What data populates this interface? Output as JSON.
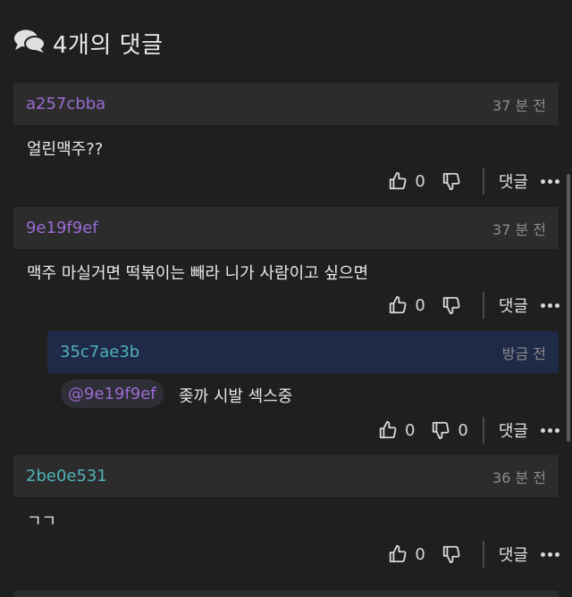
{
  "header": {
    "icon": "chat-bubbles-icon",
    "title": "4개의 댓글"
  },
  "colors": {
    "purple": "#9b6bd4",
    "teal": "#4fb3b8",
    "reply_bg": "#1e2a47"
  },
  "comments": [
    {
      "author": "a257cbba",
      "time": "37 분 전",
      "text": "얼린맥주??",
      "likes": "0",
      "dislikes": "",
      "reply_label": "댓글"
    },
    {
      "author": "9e19f9ef",
      "time": "37 분 전",
      "text": "맥주 마실거면 떡볶이는 빼라 니가 사람이고 싶으면",
      "likes": "0",
      "dislikes": "",
      "reply_label": "댓글"
    },
    {
      "author": "35c7ae3b",
      "time": "방금 전",
      "mention": "@9e19f9ef",
      "text": "좆까 시발 섹스중",
      "likes": "0",
      "dislikes": "0",
      "reply_label": "댓글"
    },
    {
      "author": "2be0e531",
      "time": "36 분 전",
      "text": "ㄱㄱ",
      "likes": "0",
      "dislikes": "",
      "reply_label": "댓글"
    }
  ]
}
